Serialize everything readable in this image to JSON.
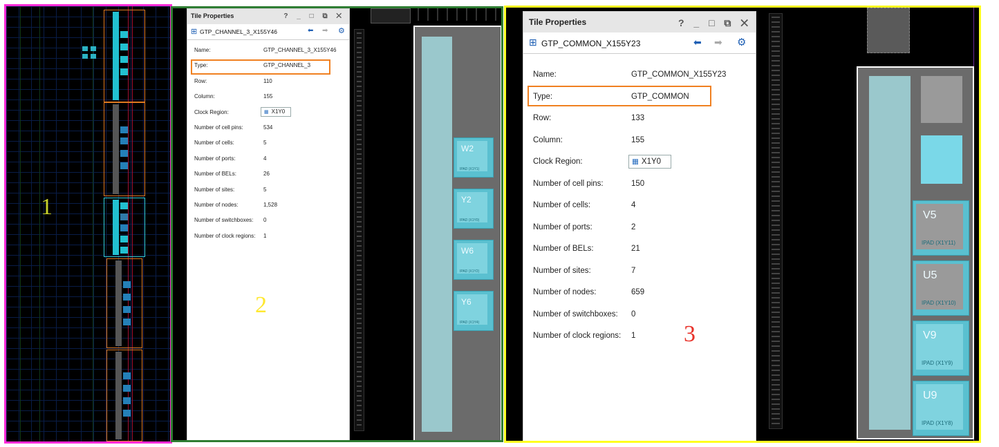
{
  "labels": {
    "one": "1",
    "two": "2",
    "three": "3"
  },
  "icons": {
    "grid": "⊞",
    "back": "⬅",
    "forward": "➡",
    "gear": "⚙",
    "clock": "▦"
  },
  "window_controls": "? _ □ ⧉ ✕",
  "panel2": {
    "title": "Tile Properties",
    "tile_name": "GTP_CHANNEL_3_X155Y46",
    "rows": [
      {
        "key": "Name:",
        "value": "GTP_CHANNEL_3_X155Y46"
      },
      {
        "key": "Type:",
        "value": "GTP_CHANNEL_3"
      },
      {
        "key": "Row:",
        "value": "110"
      },
      {
        "key": "Column:",
        "value": "155"
      },
      {
        "key": "Clock Region:",
        "value": "X1Y0"
      },
      {
        "key": "Number of cell pins:",
        "value": "534"
      },
      {
        "key": "Number of cells:",
        "value": "5"
      },
      {
        "key": "Number of ports:",
        "value": "4"
      },
      {
        "key": "Number of BELs:",
        "value": "26"
      },
      {
        "key": "Number of sites:",
        "value": "5"
      },
      {
        "key": "Number of nodes:",
        "value": "1,528"
      },
      {
        "key": "Number of switchboxes:",
        "value": "0"
      },
      {
        "key": "Number of clock regions:",
        "value": "1"
      }
    ],
    "pads": [
      {
        "pin": "W2",
        "label": "IPAD (X1Y1)"
      },
      {
        "pin": "Y2",
        "label": "IPAD (X1Y0)"
      },
      {
        "pin": "W6",
        "label": "IPAD (X1Y2)"
      },
      {
        "pin": "Y6",
        "label": "IPAD (X1Y4)"
      }
    ]
  },
  "panel3": {
    "title": "Tile Properties",
    "tile_name": "GTP_COMMON_X155Y23",
    "rows": [
      {
        "key": "Name:",
        "value": "GTP_COMMON_X155Y23"
      },
      {
        "key": "Type:",
        "value": "GTP_COMMON"
      },
      {
        "key": "Row:",
        "value": "133"
      },
      {
        "key": "Column:",
        "value": "155"
      },
      {
        "key": "Clock Region:",
        "value": "X1Y0"
      },
      {
        "key": "Number of cell pins:",
        "value": "150"
      },
      {
        "key": "Number of cells:",
        "value": "4"
      },
      {
        "key": "Number of ports:",
        "value": "2"
      },
      {
        "key": "Number of BELs:",
        "value": "21"
      },
      {
        "key": "Number of sites:",
        "value": "7"
      },
      {
        "key": "Number of nodes:",
        "value": "659"
      },
      {
        "key": "Number of switchboxes:",
        "value": "0"
      },
      {
        "key": "Number of clock regions:",
        "value": "1"
      }
    ],
    "pads": [
      {
        "pin": "V5",
        "label": "IPAD (X1Y11)"
      },
      {
        "pin": "U5",
        "label": "IPAD (X1Y10)"
      },
      {
        "pin": "V9",
        "label": "IPAD (X1Y9)"
      },
      {
        "pin": "U9",
        "label": "IPAD (X1Y8)"
      }
    ]
  },
  "colors": {
    "panel1_border": "#ff2bd8",
    "panel2_border": "#2e7d32",
    "panel3_border": "#ffff20",
    "highlight": "#f08020",
    "pad_cyan": "#5ac0d0"
  }
}
